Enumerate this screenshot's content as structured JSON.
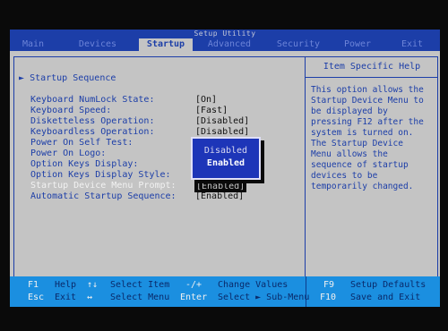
{
  "window": {
    "title": "Setup Utility"
  },
  "tabs": [
    {
      "label": "Main",
      "active": false
    },
    {
      "label": "Devices",
      "active": false
    },
    {
      "label": "Startup",
      "active": true
    },
    {
      "label": "Advanced",
      "active": false
    },
    {
      "label": "Security",
      "active": false
    },
    {
      "label": "Power",
      "active": false
    },
    {
      "label": "Exit",
      "active": false
    }
  ],
  "section": {
    "marker": "►",
    "label": "Startup Sequence"
  },
  "settings": [
    {
      "label": "Keyboard NumLock State:",
      "value": "[On]"
    },
    {
      "label": "Keyboard Speed:",
      "value": "[Fast]"
    },
    {
      "label": "Disketteless Operation:",
      "value": "[Disabled]"
    },
    {
      "label": "Keyboardless Operation:",
      "value": "[Disabled]"
    },
    {
      "label": "Power On Self Test:",
      "value": ""
    },
    {
      "label": "Power On Logo:",
      "value": ""
    },
    {
      "label": "Option Keys Display:",
      "value": ""
    },
    {
      "label": "Option Keys Display Style:",
      "value": ""
    },
    {
      "label": "Startup Device Menu Prompt:",
      "value": "[Enabled]"
    },
    {
      "label": "Automatic Startup Sequence:",
      "value": "[Enabled]"
    }
  ],
  "popup": {
    "options": [
      "Disabled",
      "Enabled"
    ],
    "selected": "Enabled"
  },
  "help": {
    "title": "Item Specific Help",
    "lines": [
      "This option allows the",
      "Startup Device Menu to",
      "be displayed by",
      "pressing F12 after the",
      "system is turned on.",
      "The Startup Device",
      "Menu allows the",
      "sequence of startup",
      "devices to be",
      "temporarily changed."
    ]
  },
  "footer": {
    "row1": [
      {
        "key": "F1",
        "action": "Help"
      },
      {
        "key": "↑↓",
        "action": "Select Item"
      },
      {
        "key": "-/+",
        "action": "Change Values"
      },
      {
        "key": "F9",
        "action": "Setup Defaults"
      }
    ],
    "row2": [
      {
        "key": "Esc",
        "action": "Exit"
      },
      {
        "key": "↔",
        "action": "Select Menu"
      },
      {
        "key": "Enter",
        "action": "Select ► Sub-Menu"
      },
      {
        "key": "F10",
        "action": "Save and Exit"
      }
    ]
  },
  "colors": {
    "background": "#c4c4c4",
    "accent_blue": "#1c3ea8",
    "footer_blue": "#1b8fe0"
  }
}
